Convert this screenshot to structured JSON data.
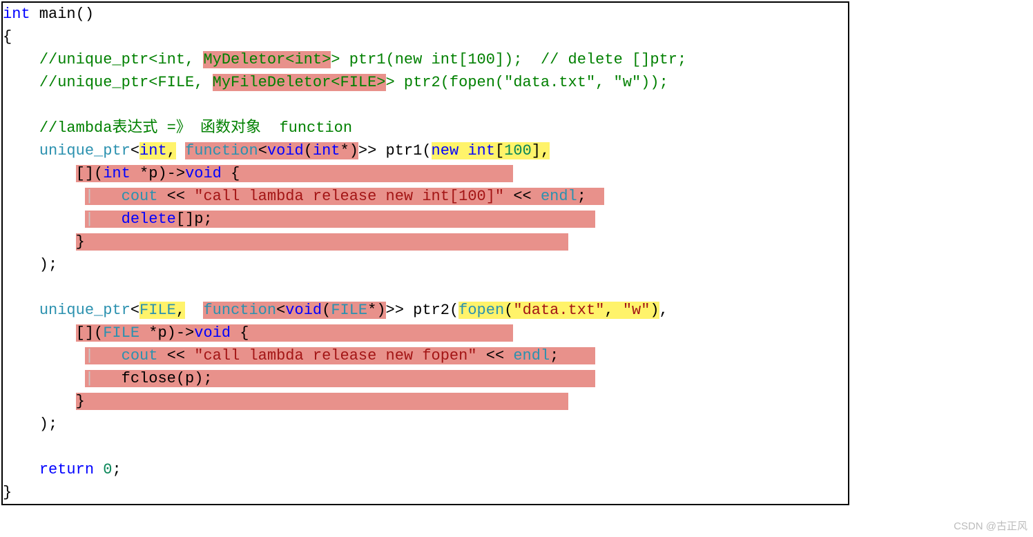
{
  "watermark": "CSDN @古正风",
  "code": {
    "l01a": "int",
    "l01b": " main()",
    "l02": "{",
    "l03a": "    ",
    "l03b": "//unique_ptr<int, ",
    "l03c": "MyDeletor<int>",
    "l03d": "> ptr1(new int[100]);  // delete []ptr;",
    "l04a": "    ",
    "l04b": "//unique_ptr<FILE, ",
    "l04c": "MyFileDeletor<FILE>",
    "l04d": "> ptr2(fopen(\"data.txt\", \"w\"));",
    "blank": "",
    "l06a": "    ",
    "l06b": "//lambda表达式 =》 函数对象  function",
    "l07a": "    ",
    "l07b": "unique_ptr",
    "l07c": "<",
    "l07d": "int",
    "l07e": ",",
    "l07f": " ",
    "l07g": "function",
    "l07h": "<",
    "l07i": "void",
    "l07j": "(",
    "l07k": "int",
    "l07l": "*)",
    "l07m": ">> ptr1(",
    "l07n": "new",
    "l07o": " ",
    "l07p": "int",
    "l07q": "[",
    "l07r": "100",
    "l07s": "],",
    "l08a": "        ",
    "l08b": "[](",
    "l08c": "int",
    "l08d": " *p)->",
    "l08e": "void",
    "l08f": " {",
    "l09a": "         ",
    "l09g": "   ",
    "l09b": "cout",
    "l09c": " << ",
    "l09d": "\"call lambda release new int[100]\"",
    "l09e": " << ",
    "l09f": "endl",
    "l09h": ";",
    "l10a": "         ",
    "l10g": "   ",
    "l10b": "delete",
    "l10c": "[]p;",
    "l11a": "        ",
    "l11b": "}",
    "l12a": "    );",
    "l14a": "    ",
    "l14b": "unique_ptr",
    "l14c": "<",
    "l14d": "FILE",
    "l14e": ",",
    "l14f": "  ",
    "l14g": "function",
    "l14h": "<",
    "l14i": "void",
    "l14j": "(",
    "l14k": "FILE",
    "l14l": "*)",
    "l14m": ">> ptr2(",
    "l14n": "fopen",
    "l14o": "(",
    "l14p": "\"data.txt\"",
    "l14q": ", ",
    "l14r": "\"w\"",
    "l14s": ")",
    "l14t": ",",
    "l15a": "        ",
    "l15b": "[](",
    "l15c": "FILE",
    "l15d": " *p)->",
    "l15e": "void",
    "l15f": " {",
    "l16a": "         ",
    "l16g": "   ",
    "l16b": "cout",
    "l16c": " << ",
    "l16d": "\"call lambda release new fopen\"",
    "l16e": " << ",
    "l16f": "endl",
    "l16h": ";",
    "l17a": "         ",
    "l17g": "   ",
    "l17b": "fclose(p);",
    "l18a": "        ",
    "l18b": "}",
    "l19a": "    );",
    "l21a": "    ",
    "l21b": "return",
    "l21c": " ",
    "l21d": "0",
    "l21e": ";",
    "l22": "}"
  }
}
